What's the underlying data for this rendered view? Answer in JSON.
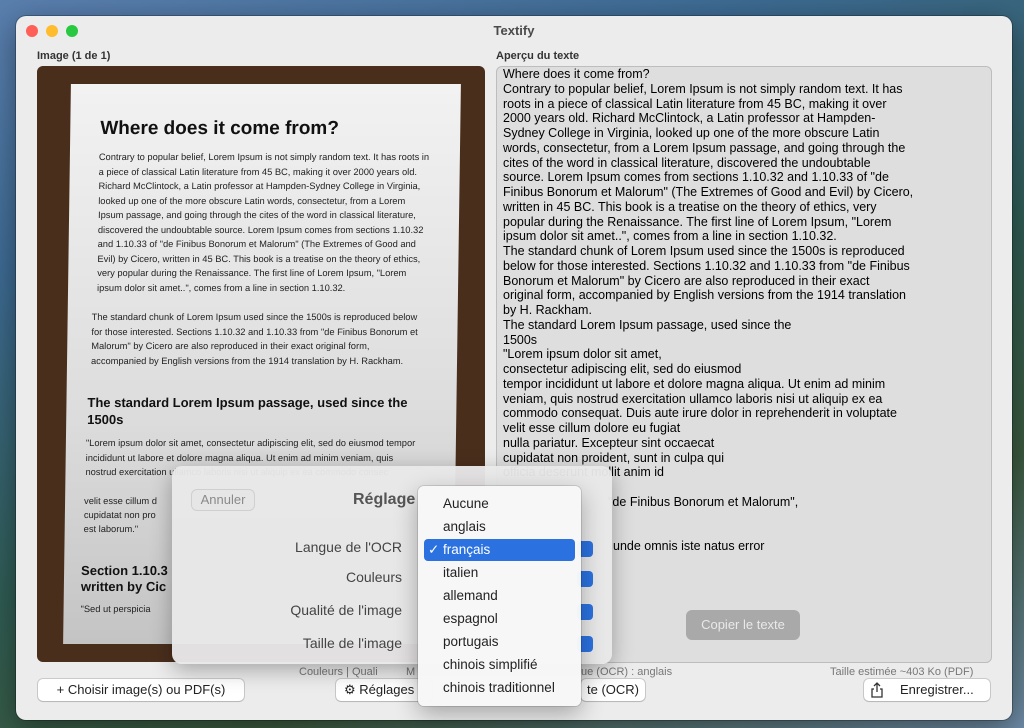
{
  "window": {
    "title": "Textify",
    "image_label": "Image (1 de 1)",
    "preview_label": "Aperçu du texte"
  },
  "photo": {
    "heading": "Where does it come from?",
    "p1": "Contrary to popular belief, Lorem Ipsum is not simply random text. It has roots in a piece of classical Latin literature from 45 BC, making it over 2000 years old. Richard McClintock, a Latin professor at Hampden-Sydney College in Virginia, looked up one of the more obscure Latin words, consectetur, from a Lorem Ipsum passage, and going through the cites of the word in classical literature, discovered the undoubtable source. Lorem Ipsum comes from sections 1.10.32 and 1.10.33 of \"de Finibus Bonorum et Malorum\" (The Extremes of Good and Evil) by Cicero, written in 45 BC. This book is a treatise on the theory of ethics, very popular during the Renaissance. The first line of Lorem Ipsum, \"Lorem ipsum dolor sit amet..\", comes from a line in section 1.10.32.",
    "p2": "The standard chunk of Lorem Ipsum used since the 1500s is reproduced below for those interested. Sections 1.10.32 and 1.10.33 from \"de Finibus Bonorum et Malorum\" by Cicero are also reproduced in their exact original form, accompanied by English versions from the 1914 translation by H. Rackham.",
    "heading2": "The standard Lorem Ipsum passage, used since the 1500s",
    "p3": "\"Lorem ipsum dolor sit amet, consectetur adipiscing elit, sed do eiusmod tempor incididunt ut labore et dolore magna aliqua. Ut enim ad minim veniam, quis nostrud exercitation ullamco laboris nisi ut aliquip ex ea commodo consec",
    "p3b": "velit esse cillum d",
    "p3c": "cupidatat non pro",
    "p3d": "est laborum.\"",
    "heading3": "Section 1.10.3",
    "heading3b": "written by Cic",
    "p4": "\"Sed ut perspicia"
  },
  "ocr_text": "Where does it come from?\nContrary to popular belief, Lorem Ipsum is not simply random text. It has\nroots in a piece of classical Latin literature from 45 BC, making it over\n2000 years old. Richard McClintock, a Latin professor at Hampden-\nSydney College in Virginia, looked up one of the more obscure Latin\nwords, consectetur, from a Lorem Ipsum passage, and going through the\ncites of the word in classical literature, discovered the undoubtable\nsource. Lorem Ipsum comes from sections 1.10.32 and 1.10.33 of \"de\nFinibus Bonorum et Malorum\" (The Extremes of Good and Evil) by Cicero,\nwritten in 45 BC. This book is a treatise on the theory of ethics, very\npopular during the Renaissance. The first line of Lorem Ipsum, \"Lorem\nipsum dolor sit amet..\", comes from a line in section 1.10.32.\nThe standard chunk of Lorem Ipsum used since the 1500s is reproduced\nbelow for those interested. Sections 1.10.32 and 1.10.33 from \"de Finibus\nBonorum et Malorum\" by Cicero are also reproduced in their exact\noriginal form, accompanied by English versions from the 1914 translation\nby H. Rackham.\nThe standard Lorem Ipsum passage, used since the\n1500s\n\"Lorem ipsum dolor sit amet,\nconsectetur adipiscing elit, sed do eiusmod\ntempor incididunt ut labore et dolore magna aliqua. Ut enim ad minim\nveniam, quis nostrud exercitation ullamco laboris nisi ut aliquip ex ea\ncommodo consequat. Duis aute irure dolor in reprehenderit in voluptate\nvelit esse cillum dolore eu fugiat\nnulla pariatur. Excepteur sint occaecat\ncupidatat non proident, sunt in culpa qui\nofficia deserunt mollit anim id",
  "ocr_fragments": {
    "f1": "\"de Finibus Bonorum et Malorum\",",
    "f2": "unde omnis iste natus error"
  },
  "copy_button": "Copier le texte",
  "status": {
    "left_a": "Couleurs | Quali",
    "left_b": "M",
    "right_a": "ue (OCR) : anglais",
    "size": "Taille estimée ~403 Ko (PDF)"
  },
  "buttons": {
    "choose": "Choisir image(s) ou PDF(s)",
    "settings": "Réglages",
    "ocr": "te (OCR)",
    "save": "Enregistrer..."
  },
  "sheet": {
    "cancel": "Annuler",
    "title": "Réglage",
    "ocr_language": "Langue de l'OCR",
    "colors": "Couleurs",
    "image_quality": "Qualité de l'image",
    "image_size": "Taille de l'image"
  },
  "menu": {
    "selected": "français",
    "items": [
      "Aucune",
      "anglais",
      "français",
      "italien",
      "allemand",
      "espagnol",
      "portugais",
      "chinois simplifié",
      "chinois traditionnel"
    ]
  },
  "colors": {
    "accent": "#2b72e0"
  }
}
